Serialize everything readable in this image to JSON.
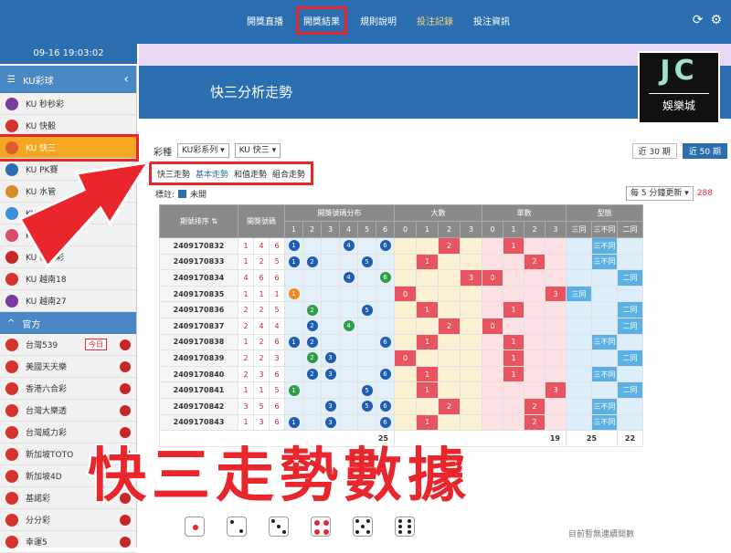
{
  "topnav": {
    "items": [
      "開獎直播",
      "開獎結果",
      "規則說明",
      "投注記錄",
      "投注資訊"
    ],
    "active_index": 1
  },
  "datetime": "09-16 19:03:02",
  "sidebar": {
    "header": "KU彩球",
    "items": [
      {
        "label": "KU 秒秒彩",
        "color": "#7a3ca0"
      },
      {
        "label": "KU 快骰",
        "color": "#d9342b"
      },
      {
        "label": "KU 快三",
        "color": "#e05a33"
      },
      {
        "label": "KU PK賽",
        "color": "#2b6fb0"
      },
      {
        "label": "KU 水管",
        "color": "#d98c2b"
      },
      {
        "label": "KU 11選5",
        "color": "#3d8ed9"
      },
      {
        "label": "KU 快樂十分",
        "color": "#d94c6a"
      },
      {
        "label": "KU 泰國彩",
        "color": "#c62828"
      },
      {
        "label": "KU 越南18",
        "color": "#d9342b"
      },
      {
        "label": "KU 越南27",
        "color": "#7a3ca0"
      }
    ],
    "section": "官方",
    "official": [
      {
        "label": "台灣539",
        "badge": "今日"
      },
      {
        "label": "美國天天樂",
        "badge": ""
      },
      {
        "label": "香港六合彩",
        "badge": ""
      },
      {
        "label": "台灣大樂透",
        "badge": ""
      },
      {
        "label": "台灣威力彩",
        "badge": ""
      },
      {
        "label": "新加坡TOTO",
        "badge": ""
      },
      {
        "label": "新加坡4D",
        "badge": ""
      },
      {
        "label": "基諾彩",
        "badge": ""
      },
      {
        "label": "分分彩",
        "badge": ""
      },
      {
        "label": "幸運5",
        "badge": ""
      }
    ]
  },
  "page_title": "快三分析走勢",
  "filters": {
    "label": "彩種",
    "series": "KU彩系列",
    "game": "KU 快三",
    "periods": [
      "近 30 期",
      "近 50 期"
    ]
  },
  "view_tabs": [
    "快三走勢",
    "基本走勢",
    "和值走勢",
    "組合走勢"
  ],
  "notes": {
    "label": "標註:",
    "checkbox": "未開"
  },
  "refresh": {
    "select": "每 5 分鐘更新",
    "count": "288"
  },
  "table": {
    "headers": {
      "period": "期號排序",
      "draw": "開獎號碼",
      "dist": "開獎號碼分布",
      "big": "大數",
      "odd": "單數",
      "type": "型態"
    },
    "dist_cols": [
      "1",
      "2",
      "3",
      "4",
      "5",
      "6"
    ],
    "big_cols": [
      "0",
      "1",
      "2",
      "3"
    ],
    "odd_cols": [
      "0",
      "1",
      "2",
      "3"
    ],
    "type_cols": [
      "三同",
      "三不同",
      "二同"
    ],
    "rows": [
      {
        "period": "2409170832",
        "draw": [
          "1",
          "4",
          "6"
        ]
      },
      {
        "period": "2409170833",
        "draw": [
          "1",
          "2",
          "5"
        ]
      },
      {
        "period": "2409170834",
        "draw": [
          "4",
          "6",
          "6"
        ]
      },
      {
        "period": "2409170835",
        "draw": [
          "1",
          "1",
          "1"
        ]
      },
      {
        "period": "2409170836",
        "draw": [
          "2",
          "2",
          "5"
        ]
      },
      {
        "period": "2409170837",
        "draw": [
          "2",
          "4",
          "4"
        ]
      },
      {
        "period": "2409170838",
        "draw": [
          "1",
          "2",
          "6"
        ]
      },
      {
        "period": "2409170839",
        "draw": [
          "2",
          "2",
          "3"
        ]
      },
      {
        "period": "2409170840",
        "draw": [
          "2",
          "3",
          "6"
        ]
      },
      {
        "period": "2409170841",
        "draw": [
          "1",
          "1",
          "5"
        ]
      },
      {
        "period": "2409170842",
        "draw": [
          "3",
          "5",
          "6"
        ]
      },
      {
        "period": "2409170843",
        "draw": [
          "1",
          "3",
          "6"
        ]
      }
    ],
    "sum_row": [
      "25",
      "19",
      "25",
      "22"
    ]
  },
  "empty_note": "目前暫無連續開數",
  "overlay_title": "快三走勢數據",
  "logo": {
    "letters": "JC",
    "name": "娛樂城"
  }
}
